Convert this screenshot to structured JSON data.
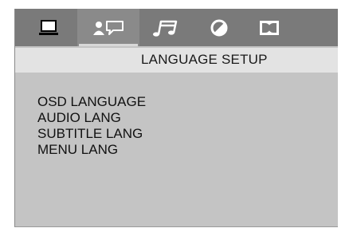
{
  "tabs": [
    {
      "name": "tab-general",
      "icon": "monitor-icon",
      "active": false
    },
    {
      "name": "tab-language",
      "icon": "person-speech-icon",
      "active": true
    },
    {
      "name": "tab-audio",
      "icon": "music-note-icon",
      "active": false
    },
    {
      "name": "tab-video",
      "icon": "contrast-circle-icon",
      "active": false
    },
    {
      "name": "tab-speaker",
      "icon": "dolby-icon",
      "active": false
    }
  ],
  "header": {
    "title": "LANGUAGE SETUP"
  },
  "menu": {
    "items": [
      {
        "label": "OSD LANGUAGE"
      },
      {
        "label": "AUDIO LANG"
      },
      {
        "label": "SUBTITLE LANG"
      },
      {
        "label": "MENU LANG"
      }
    ]
  },
  "colors": {
    "panel": "#c4c4c4",
    "tabbar": "#7a7a7a",
    "header": "#e3e3e3",
    "icon": "#ffffff"
  }
}
